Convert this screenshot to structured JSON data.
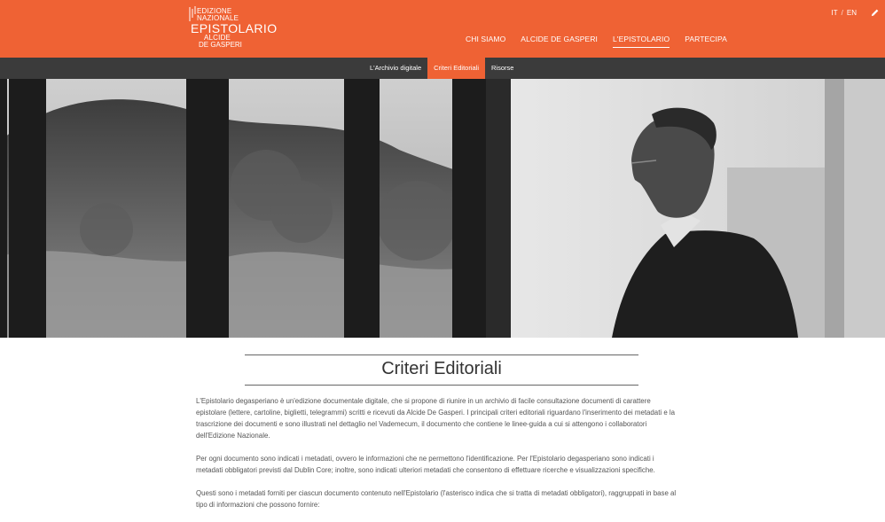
{
  "brand": {
    "line1": "EDIZIONE",
    "line2": "NAZIONALE",
    "line3": "EPISTOLARIO",
    "line4": "ALCIDE",
    "line5": "DE GASPERI",
    "accent": "#ef6234",
    "subbar_color": "#3b3b3b"
  },
  "lang": {
    "it": "IT",
    "separator": "/",
    "en": "EN"
  },
  "edit_icon": "pencil-icon",
  "main_nav": [
    {
      "label": "CHI SIAMO",
      "active": false
    },
    {
      "label": "ALCIDE DE GASPERI",
      "active": false
    },
    {
      "label": "L'EPISTOLARIO",
      "active": true
    },
    {
      "label": "PARTECIPA",
      "active": false
    }
  ],
  "sub_nav": [
    {
      "label": "L'Archivio digitale",
      "active": false
    },
    {
      "label": "Criteri Editoriali",
      "active": true
    },
    {
      "label": "Risorse",
      "active": false
    }
  ],
  "page": {
    "title": "Criteri Editoriali",
    "paragraphs": [
      "L'Epistolario degasperiano è un'edizione documentale digitale, che si propone di riunire in un archivio di facile consultazione documenti di carattere epistolare (lettere, cartoline, biglietti, telegrammi) scritti e ricevuti da Alcide De Gasperi. I principali criteri editoriali riguardano l'inserimento dei metadati e la trascrizione dei documenti e sono illustrati nel dettaglio nel Vademecum, il documento che contiene le linee-guida a cui si attengono i collaboratori dell'Edizione Nazionale.",
      "Per ogni documento sono indicati i metadati, ovvero le informazioni che ne permettono l'identificazione. Per l'Epistolario degasperiano sono indicati i metadati obbligatori previsti dal Dublin Core; inoltre, sono indicati ulteriori metadati che consentono di effettuare ricerche e visualizzazioni specifiche.",
      "Questi sono i metadati forniti per ciascun documento contenuto nell'Epistolario (l'asterisco indica che si tratta di metadati obbligatori), raggruppati in base al tipo di informazioni che possono fornire:"
    ]
  }
}
